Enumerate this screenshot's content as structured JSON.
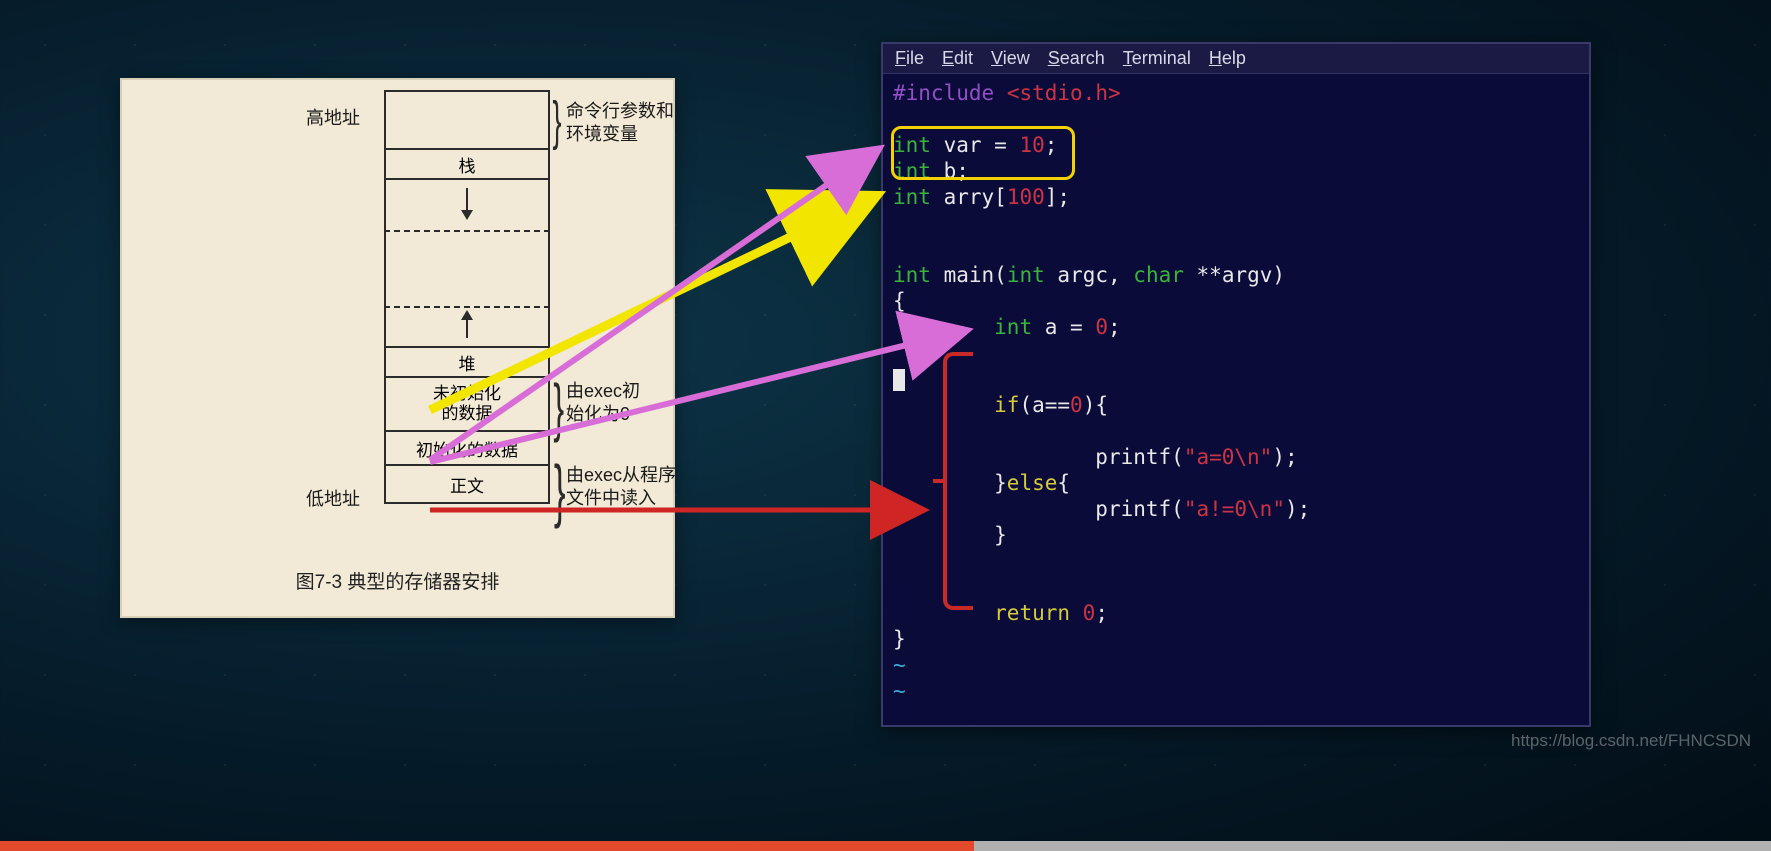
{
  "diagram": {
    "label_high": "高地址",
    "label_low": "低地址",
    "row_args_annot": "命令行参数和\n环境变量",
    "row_stack": "栈",
    "row_heap": "堆",
    "row_bss": "未初始化\n的数据",
    "row_bss_annot": "由exec初\n始化为0",
    "row_data": "初始化的数据",
    "row_text": "正文",
    "row_text_annot": "由exec从程序\n文件中读入",
    "caption": "图7-3  典型的存储器安排"
  },
  "editor": {
    "menu": {
      "file": "File",
      "edit": "Edit",
      "view": "View",
      "search": "Search",
      "terminal": "Terminal",
      "help": "Help"
    },
    "code": {
      "include_directive": "#include",
      "include_header": "<stdio.h>",
      "kw_int": "int",
      "var_name": "var",
      "var_init": "10",
      "b_name": "b",
      "arry_name": "arry",
      "arry_size": "100",
      "main_name": "main",
      "argc": "argc",
      "kw_char": "char",
      "argv": "**argv",
      "a_name": "a",
      "a_init": "0",
      "kw_if": "if",
      "cond": "a==",
      "cond_zero": "0",
      "printf1": "printf",
      "str1": "\"a=0\\n\"",
      "kw_else": "else",
      "printf2": "printf",
      "str2": "\"a!=0\\n\"",
      "kw_return": "return",
      "ret_val": "0"
    }
  },
  "watermark": "https://blog.csdn.net/FHNCSDN"
}
